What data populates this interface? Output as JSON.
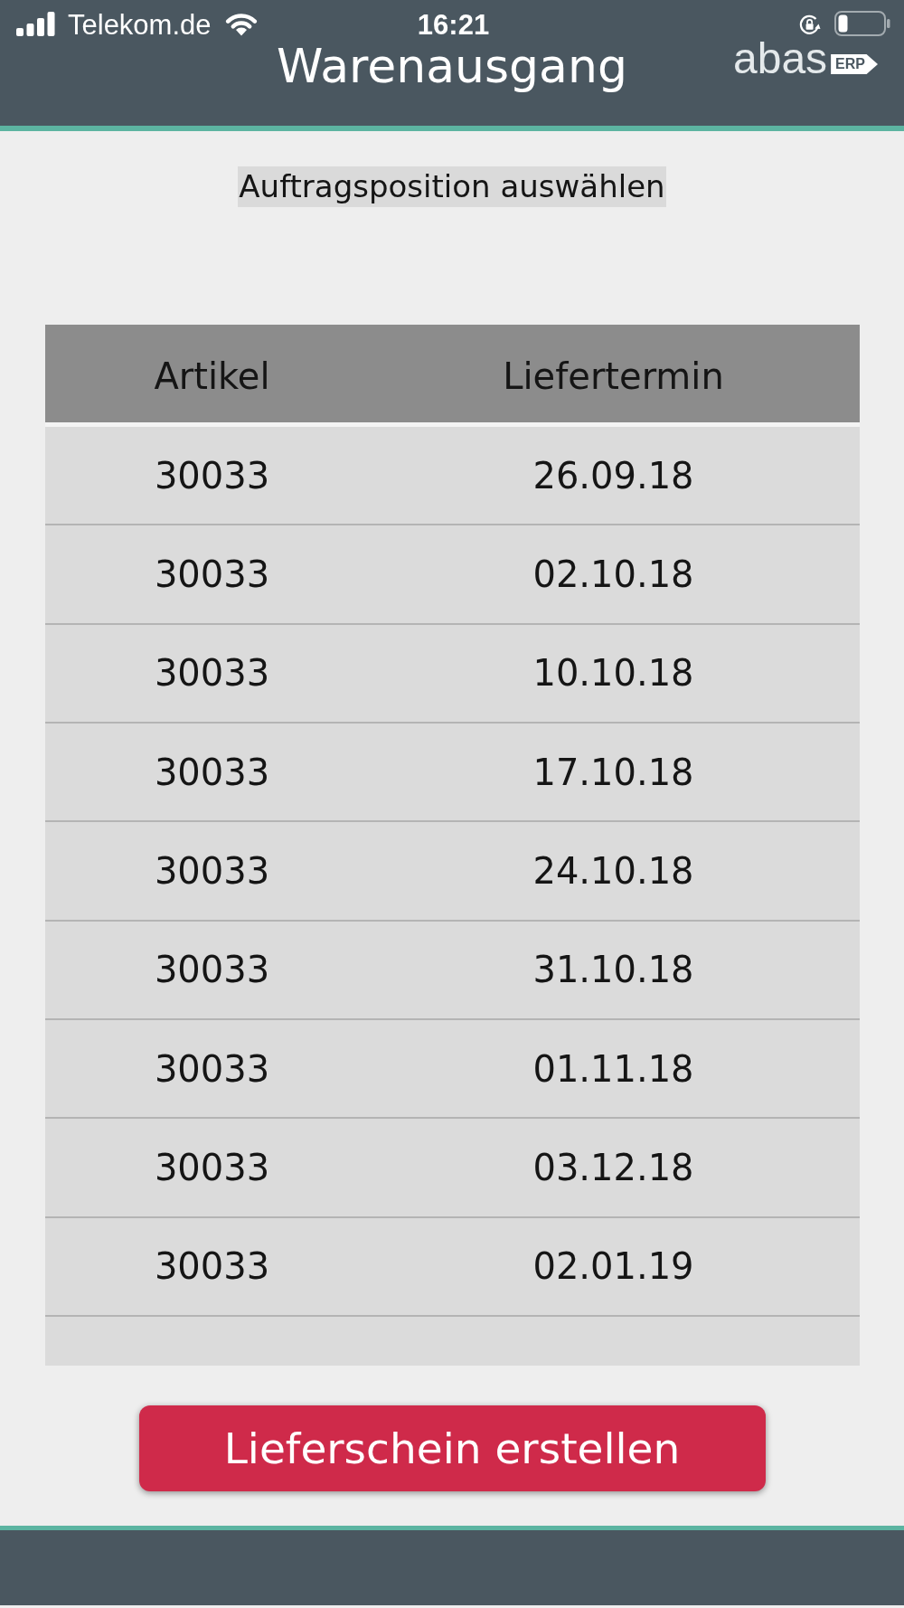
{
  "status_bar": {
    "carrier": "Telekom.de",
    "time": "16:21"
  },
  "header": {
    "title": "Warenausgang",
    "logo": {
      "wordmark": "abas",
      "badge": "ERP"
    }
  },
  "instruction": "Auftragsposition auswählen",
  "table": {
    "columns": [
      "Artikel",
      "Liefertermin"
    ],
    "rows": [
      [
        "30033",
        "26.09.18"
      ],
      [
        "30033",
        "02.10.18"
      ],
      [
        "30033",
        "10.10.18"
      ],
      [
        "30033",
        "17.10.18"
      ],
      [
        "30033",
        "24.10.18"
      ],
      [
        "30033",
        "31.10.18"
      ],
      [
        "30033",
        "01.11.18"
      ],
      [
        "30033",
        "03.12.18"
      ],
      [
        "30033",
        "02.01.19"
      ]
    ]
  },
  "button": {
    "label": "Lieferschein erstellen"
  }
}
